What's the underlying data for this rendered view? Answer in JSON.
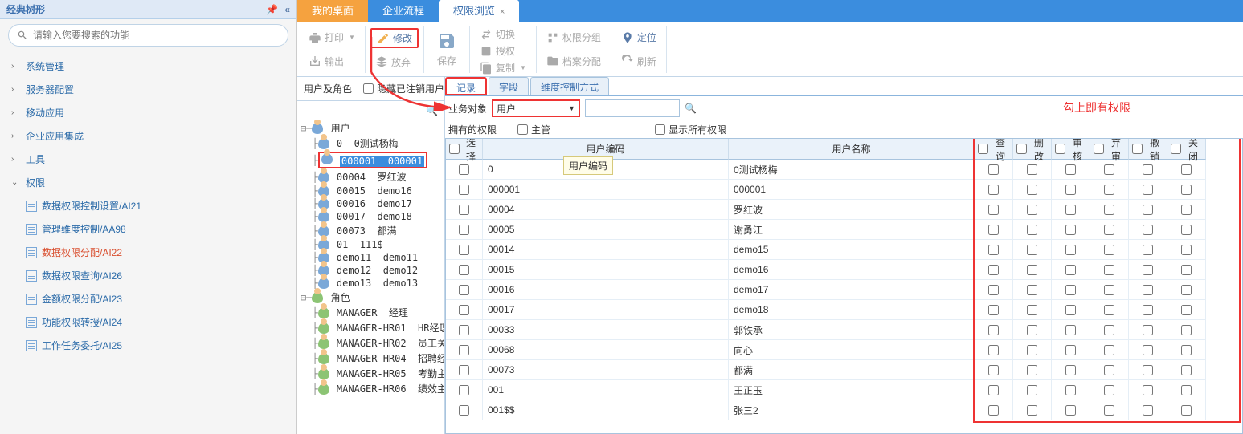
{
  "sidebar": {
    "title": "经典树形",
    "search_placeholder": "请输入您要搜索的功能",
    "items": [
      {
        "label": "系统管理",
        "expanded": false
      },
      {
        "label": "服务器配置",
        "expanded": false
      },
      {
        "label": "移动应用",
        "expanded": false
      },
      {
        "label": "企业应用集成",
        "expanded": false
      },
      {
        "label": "工具",
        "expanded": false
      },
      {
        "label": "权限",
        "expanded": true
      }
    ],
    "sub_items": [
      {
        "label": "数据权限控制设置/AI21",
        "active": false
      },
      {
        "label": "管理维度控制/AA98",
        "active": false
      },
      {
        "label": "数据权限分配/AI22",
        "active": true
      },
      {
        "label": "数据权限查询/AI26",
        "active": false
      },
      {
        "label": "金额权限分配/AI23",
        "active": false
      },
      {
        "label": "功能权限转授/AI24",
        "active": false
      },
      {
        "label": "工作任务委托/AI25",
        "active": false
      }
    ]
  },
  "tabs": [
    {
      "label": "我的桌面",
      "type": "orange"
    },
    {
      "label": "企业流程",
      "type": "blue"
    },
    {
      "label": "权限浏览",
      "type": "active",
      "closable": true
    }
  ],
  "toolbar": {
    "print": "打印",
    "export": "输出",
    "modify": "修改",
    "abandon": "放弃",
    "save": "保存",
    "copy": "复制",
    "switch": "切换",
    "authorize": "授权",
    "archive": "档案分配",
    "perm_group": "权限分组",
    "locate": "定位",
    "refresh": "刷新"
  },
  "filter": {
    "user_role_label": "用户及角色",
    "hide_cancelled": "隐藏已注销用户"
  },
  "user_tree": {
    "user_root": "用户",
    "users": [
      {
        "code": "0",
        "name": "0测试杨梅"
      },
      {
        "code": "000001",
        "name": "000001",
        "selected": true
      },
      {
        "code": "00004",
        "name": "罗红波"
      },
      {
        "code": "00015",
        "name": "demo16"
      },
      {
        "code": "00016",
        "name": "demo17"
      },
      {
        "code": "00017",
        "name": "demo18"
      },
      {
        "code": "00073",
        "name": "都满"
      },
      {
        "code": "01",
        "name": "111$"
      },
      {
        "code": "demo11",
        "name": "demo11"
      },
      {
        "code": "demo12",
        "name": "demo12"
      },
      {
        "code": "demo13",
        "name": "demo13"
      }
    ],
    "role_root": "角色",
    "roles": [
      {
        "code": "MANAGER",
        "name": "经理"
      },
      {
        "code": "MANAGER-HR01",
        "name": "HR经理"
      },
      {
        "code": "MANAGER-HR02",
        "name": "员工关"
      },
      {
        "code": "MANAGER-HR04",
        "name": "招聘经"
      },
      {
        "code": "MANAGER-HR05",
        "name": "考勤主"
      },
      {
        "code": "MANAGER-HR06",
        "name": "绩效主"
      }
    ]
  },
  "subtabs": [
    {
      "label": "记录",
      "active": true,
      "redbox": true
    },
    {
      "label": "字段",
      "active": false
    },
    {
      "label": "维度控制方式",
      "active": false
    }
  ],
  "bo": {
    "label": "业务对象",
    "value": "用户"
  },
  "permissions_label": "拥有的权限",
  "supervisor_label": "主管",
  "show_all_label": "显示所有权限",
  "annotation": "勾上即有权限",
  "table": {
    "columns": [
      "选择",
      "用户编码",
      "用户名称",
      "查询",
      "删改",
      "审核",
      "弃审",
      "撤销",
      "关闭"
    ],
    "tooltip": "用户编码",
    "rows": [
      {
        "code": "0",
        "name": "0测试杨梅"
      },
      {
        "code": "000001",
        "name": "000001"
      },
      {
        "code": "00004",
        "name": "罗红波"
      },
      {
        "code": "00005",
        "name": "谢勇江"
      },
      {
        "code": "00014",
        "name": "demo15"
      },
      {
        "code": "00015",
        "name": "demo16"
      },
      {
        "code": "00016",
        "name": "demo17"
      },
      {
        "code": "00017",
        "name": "demo18"
      },
      {
        "code": "00033",
        "name": "郭铁承"
      },
      {
        "code": "00068",
        "name": "向心"
      },
      {
        "code": "00073",
        "name": "都满"
      },
      {
        "code": "001",
        "name": "王正玉"
      },
      {
        "code": "001$$",
        "name": "张三2"
      }
    ]
  }
}
